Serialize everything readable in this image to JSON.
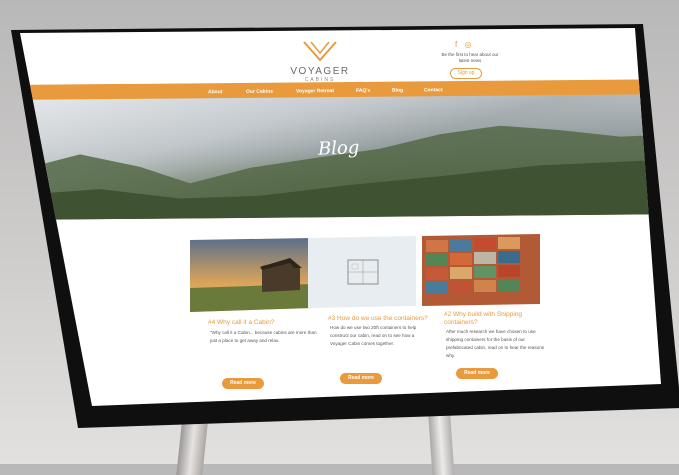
{
  "brand": {
    "name": "VOYAGER",
    "subtitle": "CABINS",
    "tagline": "Be the first to hear about our latest news",
    "signup_label": "Sign up"
  },
  "nav": {
    "items": [
      "About",
      "Our Cabins",
      "Voyager Retreat",
      "FAQ's",
      "Blog",
      "Contact"
    ]
  },
  "hero": {
    "title": "Blog"
  },
  "posts": [
    {
      "title": "#4 Why call it a Cabin?",
      "excerpt": "\"Why call it a Cabin... because cabins are more than just a place to get away and relax.",
      "button": "Read more"
    },
    {
      "title": "#3 How do we use the containers?",
      "excerpt": "How do we use two 20ft containers to help construct our cabin, read on to see how a Voyager Cabin comes together.",
      "button": "Read more"
    },
    {
      "title": "#2 Why build with Shipping containers?",
      "excerpt": "After much research we have chosen to use shipping containers for the basis of our prefabricated cabin, read on to hear the reasons why.",
      "button": "Read more"
    }
  ],
  "colors": {
    "accent": "#e89a3c",
    "bezel": "#0f0f10"
  },
  "icons": [
    "facebook-icon",
    "instagram-icon",
    "voyager-logo-icon"
  ]
}
